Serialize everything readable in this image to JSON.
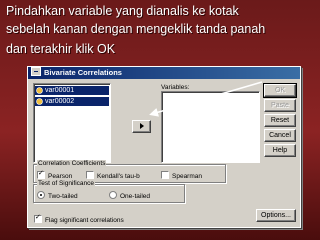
{
  "caption": {
    "line1": "Pindahkan variable yang  dianalis ke kotak",
    "line2": "sebelah kanan dengan mengeklik tanda panah",
    "line3": "dan terakhir klik OK"
  },
  "dialog": {
    "title": "Bivariate Correlations",
    "source_variables": [
      "var00001",
      "var00002"
    ],
    "variables_label": "Variables:",
    "buttons": {
      "ok": "OK",
      "paste": "Paste",
      "reset": "Reset",
      "cancel": "Cancel",
      "help": "Help",
      "options": "Options..."
    },
    "correlation_coefficients": {
      "legend": "Correlation Coefficients",
      "pearson": {
        "label": "Pearson",
        "checked": true
      },
      "kendall": {
        "label": "Kendall's tau-b",
        "checked": false
      },
      "spearman": {
        "label": "Spearman",
        "checked": false
      }
    },
    "test_of_significance": {
      "legend": "Test of Significance",
      "two_tailed": {
        "label": "Two-tailed",
        "selected": true
      },
      "one_tailed": {
        "label": "One-tailed",
        "selected": false
      }
    },
    "flag_significant": {
      "label": "Flag significant correlations",
      "checked": true
    }
  },
  "colors": {
    "background": "#8b2323",
    "titlebar": "#0a246a",
    "dialog_face": "#d4d0c8",
    "selection": "#0a246a",
    "pointer_arrow": "#ffffff"
  },
  "icons": [
    "app-icon",
    "variable-icon",
    "right-arrow-icon",
    "pointer-arrow-icon"
  ]
}
